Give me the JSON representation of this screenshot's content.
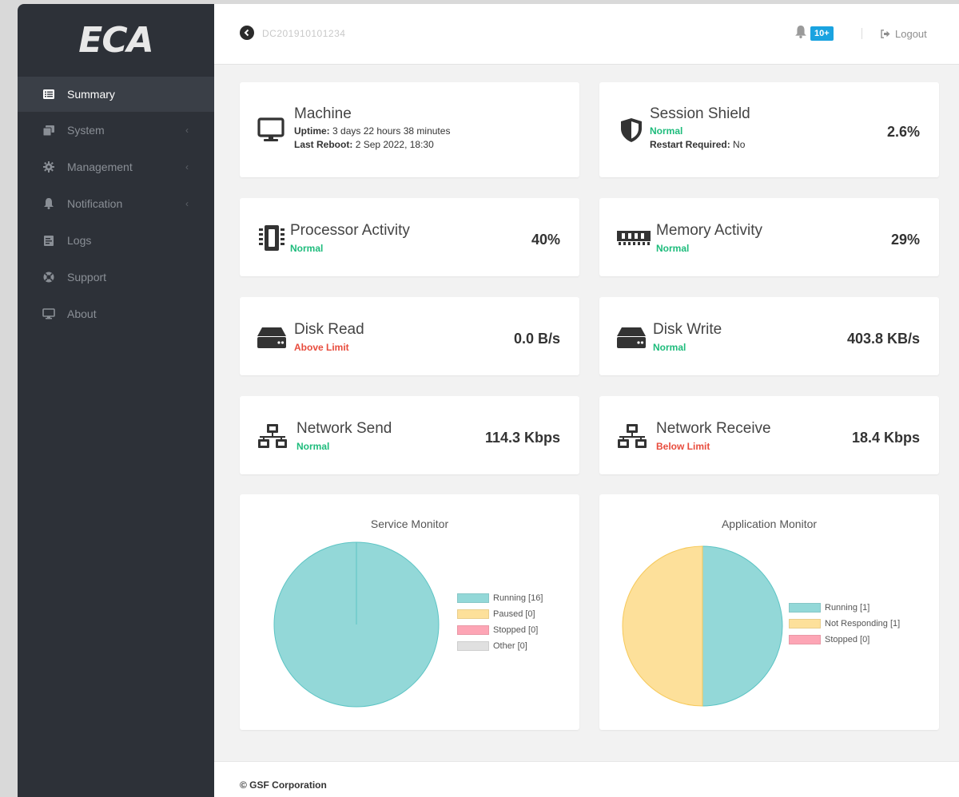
{
  "brand": {
    "logo_text": "ECA"
  },
  "sidebar": {
    "items": [
      {
        "label": "Summary",
        "icon": "list-icon",
        "active": true,
        "has_children": false
      },
      {
        "label": "System",
        "icon": "copy-icon",
        "active": false,
        "has_children": true
      },
      {
        "label": "Management",
        "icon": "gear-icon",
        "active": false,
        "has_children": true
      },
      {
        "label": "Notification",
        "icon": "bell-icon",
        "active": false,
        "has_children": true
      },
      {
        "label": "Logs",
        "icon": "document-icon",
        "active": false,
        "has_children": false
      },
      {
        "label": "Support",
        "icon": "lifebuoy-icon",
        "active": false,
        "has_children": false
      },
      {
        "label": "About",
        "icon": "monitor-icon",
        "active": false,
        "has_children": false
      }
    ],
    "chevron": "‹"
  },
  "header": {
    "host_id": "DC201910101234",
    "notification_count": "10+",
    "logout_label": "Logout"
  },
  "cards": {
    "machine": {
      "title": "Machine",
      "uptime_label": "Uptime:",
      "uptime_value": "3 days 22 hours 38 minutes",
      "reboot_label": "Last Reboot:",
      "reboot_value": "2 Sep 2022, 18:30"
    },
    "shield": {
      "title": "Session Shield",
      "status": "Normal",
      "restart_label": "Restart Required:",
      "restart_value": "No",
      "value": "2.6%"
    },
    "processor": {
      "title": "Processor Activity",
      "status": "Normal",
      "value": "40%"
    },
    "memory": {
      "title": "Memory Activity",
      "status": "Normal",
      "value": "29%"
    },
    "disk_read": {
      "title": "Disk Read",
      "status": "Above Limit",
      "value": "0.0 B/s"
    },
    "disk_write": {
      "title": "Disk Write",
      "status": "Normal",
      "value": "403.8 KB/s"
    },
    "net_send": {
      "title": "Network Send",
      "status": "Normal",
      "value": "114.3 Kbps"
    },
    "net_receive": {
      "title": "Network Receive",
      "status": "Below Limit",
      "value": "18.4 Kbps"
    }
  },
  "colors": {
    "ok": "#1ebc7c",
    "bad": "#e84c3d",
    "running": "#93d8d8",
    "paused": "#fde09a",
    "stopped": "#fda5b5",
    "other": "#e0e0e0",
    "badge": "#1aa3e0"
  },
  "chart_data": [
    {
      "type": "pie",
      "title": "Service Monitor",
      "legend_placement": "right",
      "slices": [
        {
          "label": "Running [16]",
          "value": 16,
          "color": "#93d8d8"
        },
        {
          "label": "Paused [0]",
          "value": 0,
          "color": "#fde09a"
        },
        {
          "label": "Stopped [0]",
          "value": 0,
          "color": "#fda5b5"
        },
        {
          "label": "Other [0]",
          "value": 0,
          "color": "#e0e0e0"
        }
      ]
    },
    {
      "type": "pie",
      "title": "Application Monitor",
      "legend_placement": "right",
      "slices": [
        {
          "label": "Running [1]",
          "value": 1,
          "color": "#93d8d8"
        },
        {
          "label": "Not Responding [1]",
          "value": 1,
          "color": "#fde09a"
        },
        {
          "label": "Stopped [0]",
          "value": 0,
          "color": "#fda5b5"
        }
      ]
    }
  ],
  "footer": {
    "copyright": "© GSF Corporation"
  }
}
